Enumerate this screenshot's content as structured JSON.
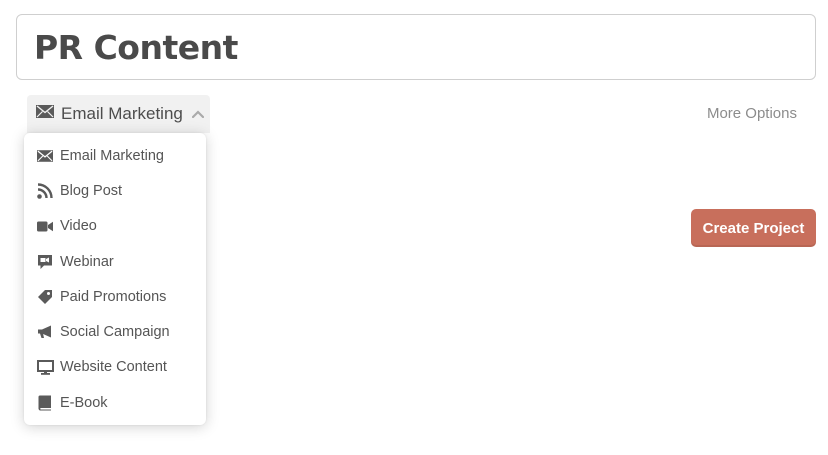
{
  "project": {
    "title": "PR Content"
  },
  "type_selector": {
    "selected_label": "Email Marketing",
    "selected_icon": "envelope-icon"
  },
  "more_options_label": "More Options",
  "menu": {
    "items": [
      {
        "label": "Email Marketing",
        "icon": "envelope-icon"
      },
      {
        "label": "Blog Post",
        "icon": "rss-icon"
      },
      {
        "label": "Video",
        "icon": "video-camera-icon"
      },
      {
        "label": "Webinar",
        "icon": "webinar-icon"
      },
      {
        "label": "Paid Promotions",
        "icon": "tag-icon"
      },
      {
        "label": "Social Campaign",
        "icon": "megaphone-icon"
      },
      {
        "label": "Website Content",
        "icon": "monitor-icon"
      },
      {
        "label": "E-Book",
        "icon": "book-icon"
      }
    ]
  },
  "create_button_label": "Create Project",
  "colors": {
    "accent": "#c86f5c",
    "icon": "#5a5a5a"
  }
}
